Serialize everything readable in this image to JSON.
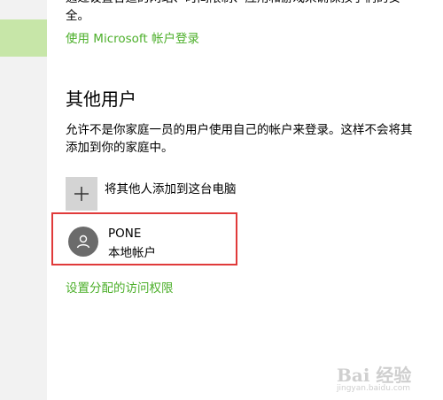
{
  "intro": {
    "text": "通过设置合适的网站、时间限制、应用和游戏来确保孩子们的安全。"
  },
  "links": {
    "microsoft_login": "使用 Microsoft 帐户登录",
    "assigned_access": "设置分配的访问权限"
  },
  "other_users": {
    "title": "其他用户",
    "description": "允许不是你家庭一员的用户使用自己的帐户来登录。这样不会将其添加到你的家庭中。",
    "add_label": "将其他人添加到这台电脑",
    "add_icon": "plus-icon"
  },
  "user": {
    "name": "PONE",
    "type": "本地帐户",
    "icon": "person-icon"
  },
  "watermark": {
    "brand": "Bai 经验",
    "sub": "jingyan.baidu.com"
  },
  "colors": {
    "link": "#4caf2a",
    "highlight_border": "#e03a3a",
    "sidebar_active": "#c7e6a8"
  }
}
